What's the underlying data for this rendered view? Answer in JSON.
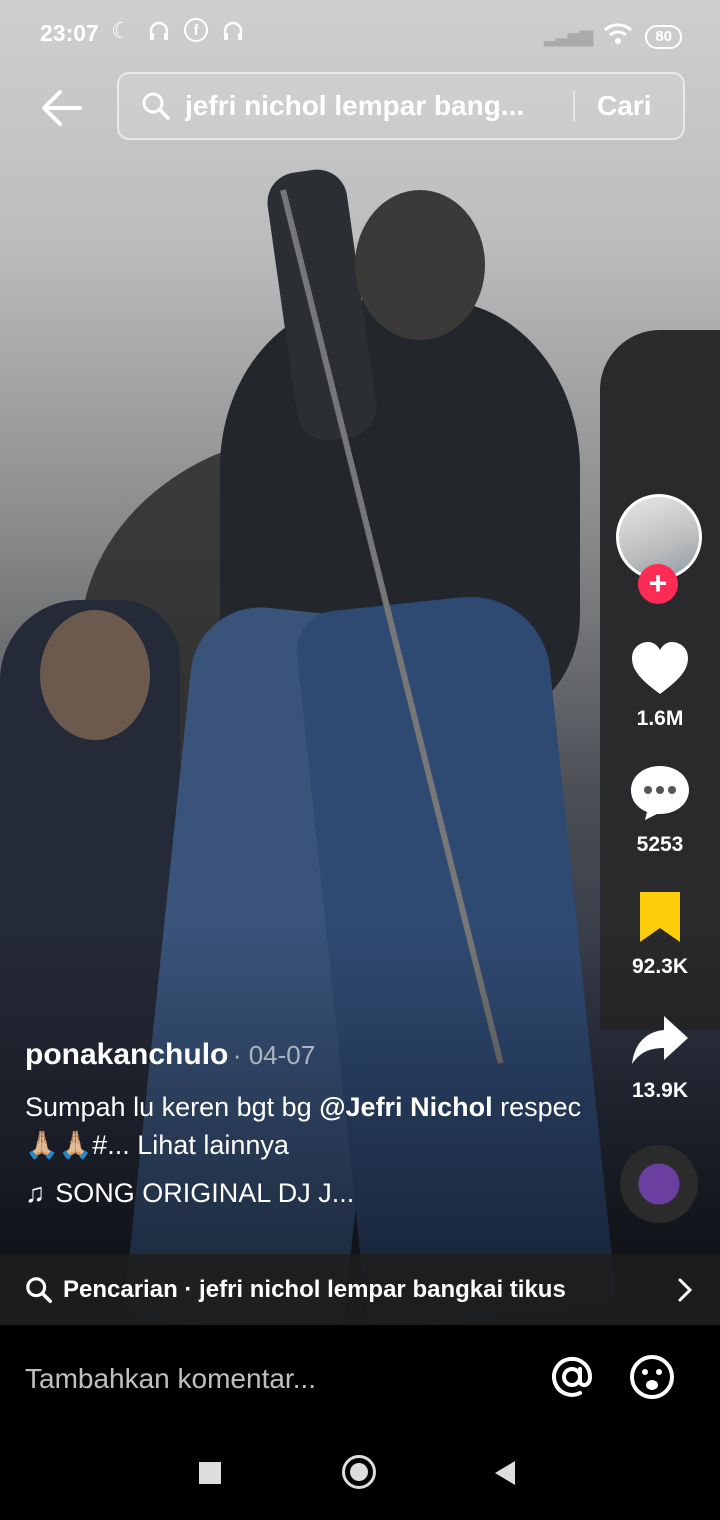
{
  "status_bar": {
    "time": "23:07",
    "battery": "80"
  },
  "search": {
    "query": "jefri nichol lempar bang...",
    "button_label": "Cari"
  },
  "rail": {
    "likes": "1.6M",
    "comments": "5253",
    "saves": "92.3K",
    "shares": "13.9K",
    "bookmark_color": "#fdcd0a",
    "follow_color": "#fe2c55"
  },
  "caption": {
    "author": "ponakanchulo",
    "date": "· 04-07",
    "text_prefix": "Sumpah lu keren bgt bg ",
    "mention": "@Jefri Nichol",
    "text_suffix": " respec🙏🏼🙏🏼#...",
    "more_label": "Lihat lainnya",
    "song": "SONG ORIGINAL DJ J..."
  },
  "related_search": {
    "label": "Pencarian · jefri nichol lempar bangkai tikus"
  },
  "comment_bar": {
    "placeholder": "Tambahkan komentar..."
  }
}
